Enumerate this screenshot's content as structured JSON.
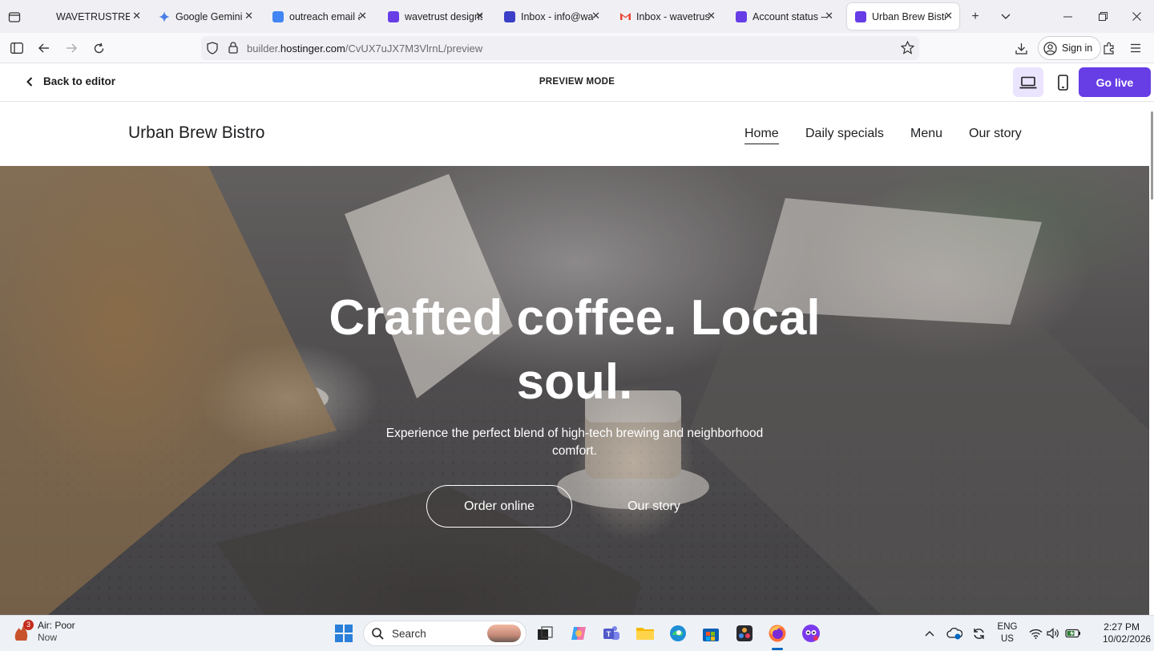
{
  "browser": {
    "tabs": [
      {
        "label": "WAVETRUSTREVIEWS",
        "color": "#888888"
      },
      {
        "label": "Google Gemini",
        "color": "#4a7fe6"
      },
      {
        "label": "outreach email and",
        "color": "#4285f4"
      },
      {
        "label": "wavetrust designs",
        "color": "#673de6"
      },
      {
        "label": "Inbox - info@wavetrust",
        "color": "#3b3fc7"
      },
      {
        "label": "Inbox - wavetrustco",
        "color": "#ea4335"
      },
      {
        "label": "Account status – wavetrust",
        "color": "#673de6"
      },
      {
        "label": "Urban Brew Bistro",
        "color": "#673de6"
      }
    ],
    "url_host_prefix": "builder.",
    "url_host": "hostinger.com",
    "url_path": "/CvUX7uJX7M3VlrnL/preview",
    "signin_label": "Sign in"
  },
  "editor": {
    "back_label": "Back to editor",
    "mode_label": "PREVIEW MODE",
    "golive_label": "Go live",
    "accent": "#673de6"
  },
  "site": {
    "brand": "Urban Brew Bistro",
    "nav": [
      "Home",
      "Daily specials",
      "Menu",
      "Our story"
    ],
    "hero": {
      "title": "Crafted coffee. Local soul.",
      "subtitle": "Experience the perfect blend of high-tech brewing and neighborhood comfort.",
      "primary_cta": "Order online",
      "secondary_cta": "Our story"
    }
  },
  "taskbar": {
    "weather_title": "Air: Poor",
    "weather_sub": "Now",
    "weather_badge": "3",
    "search_placeholder": "Search",
    "lang_top": "ENG",
    "lang_bottom": "US",
    "time": "2:27 PM",
    "date": "10/02/2026"
  }
}
